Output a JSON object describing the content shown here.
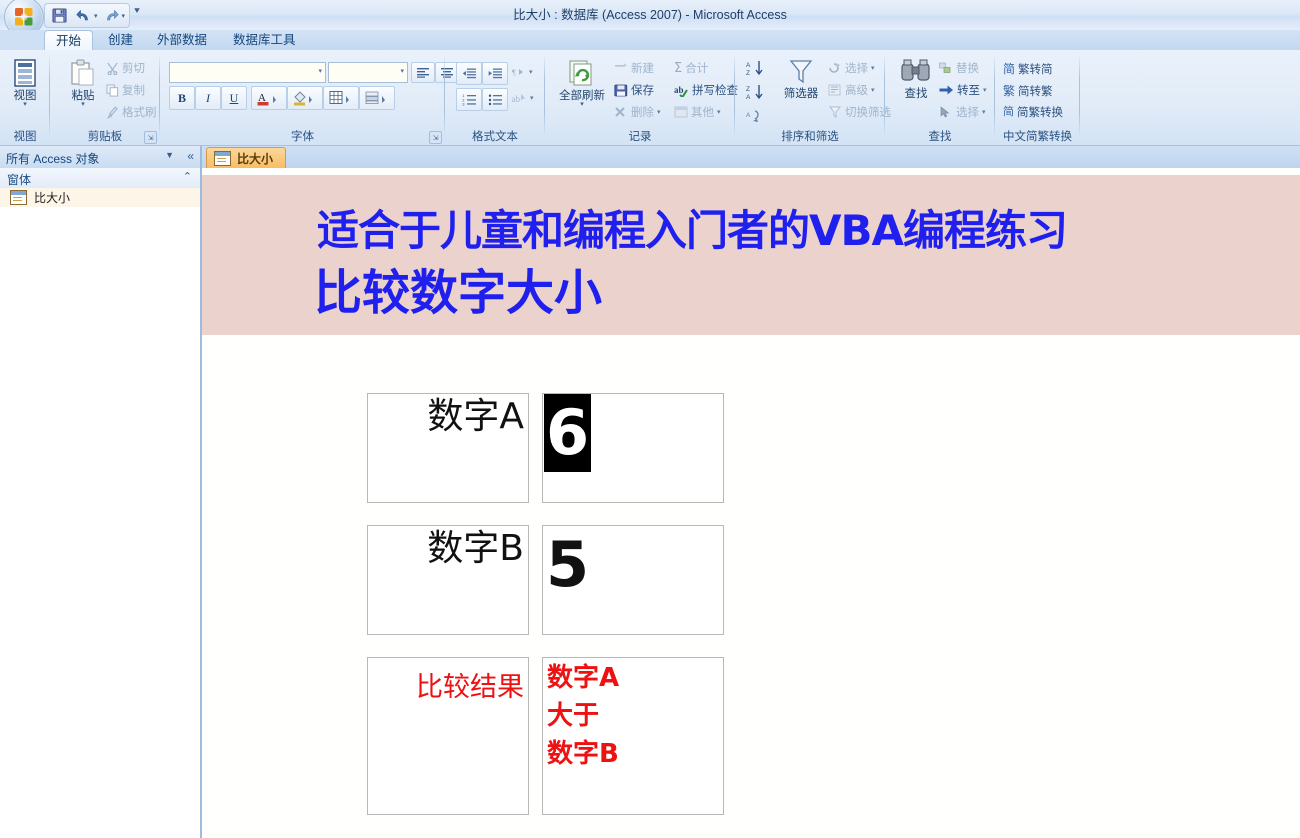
{
  "window": {
    "title": "比大小 : 数据库 (Access 2007) - Microsoft Access",
    "office_button": "office-orb"
  },
  "quick_access": {
    "save": "保存",
    "undo": "撤消",
    "redo": "恢复",
    "customize": "自定义快速访问工具栏"
  },
  "ribbon": {
    "tabs": [
      {
        "label": "开始",
        "active": true
      },
      {
        "label": "创建",
        "active": false
      },
      {
        "label": "外部数据",
        "active": false
      },
      {
        "label": "数据库工具",
        "active": false
      }
    ],
    "groups": [
      {
        "name": "view",
        "label": "视图",
        "buttons": [
          {
            "label": "视图",
            "dropdown": "▾"
          }
        ]
      },
      {
        "name": "clipboard",
        "label": "剪贴板",
        "buttons": [
          {
            "label": "粘贴",
            "dropdown": "▾"
          },
          {
            "label": "剪切"
          },
          {
            "label": "复制"
          },
          {
            "label": "格式刷"
          }
        ]
      },
      {
        "name": "font",
        "label": "字体",
        "font_name": "",
        "font_size": "",
        "buttons": [
          {
            "label": "B"
          },
          {
            "label": "I"
          },
          {
            "label": "U"
          },
          {
            "label": "字体颜色"
          },
          {
            "label": "填充颜色"
          },
          {
            "label": "网格线"
          },
          {
            "label": "备用填充色"
          },
          {
            "label": "左对齐"
          },
          {
            "label": "居中"
          },
          {
            "label": "右对齐"
          }
        ]
      },
      {
        "name": "rich-text",
        "label": "格式文本",
        "buttons": [
          {
            "label": "减少缩进"
          },
          {
            "label": "增加缩进"
          },
          {
            "label": "从右向左"
          },
          {
            "label": "编号"
          },
          {
            "label": "项目符号"
          },
          {
            "label": "拼音指南"
          }
        ]
      },
      {
        "name": "records",
        "label": "记录",
        "buttons": [
          {
            "label": "全部刷新",
            "dropdown": "▾"
          },
          {
            "label": "新建"
          },
          {
            "label": "保存"
          },
          {
            "label": "删除",
            "dropdown": "▾"
          },
          {
            "label": "合计"
          },
          {
            "label": "拼写检查"
          },
          {
            "label": "其他",
            "dropdown": "▾"
          }
        ]
      },
      {
        "name": "sort-filter",
        "label": "排序和筛选",
        "buttons": [
          {
            "label": "升序"
          },
          {
            "label": "降序"
          },
          {
            "label": "清除所有排序"
          },
          {
            "label": "筛选器"
          },
          {
            "label": "选择",
            "dropdown": "▾"
          },
          {
            "label": "高级",
            "dropdown": "▾"
          },
          {
            "label": "切换筛选"
          }
        ]
      },
      {
        "name": "find",
        "label": "查找",
        "buttons": [
          {
            "label": "查找"
          },
          {
            "label": "替换"
          },
          {
            "label": "转至",
            "dropdown": "▾"
          },
          {
            "label": "选择",
            "dropdown": "▾"
          }
        ]
      },
      {
        "name": "chinese-conversion",
        "label": "中文简繁转换",
        "buttons": [
          {
            "label": "繁转简"
          },
          {
            "label": "简转繁"
          },
          {
            "label": "简繁转换"
          }
        ]
      }
    ]
  },
  "nav_pane": {
    "header_title": "所有 Access 对象",
    "dropdown_icon": "chevron-down-icon",
    "collapse_icon": "«",
    "group_label": "窗体",
    "group_chevron": "⌃",
    "items": [
      {
        "label": "比大小",
        "icon": "form-icon"
      }
    ]
  },
  "doc_tabs": [
    {
      "label": "比大小",
      "icon": "form-icon",
      "active": true
    }
  ],
  "form": {
    "header": {
      "line1": "适合于儿童和编程入门者的VBA编程练习",
      "line2": "比较数字大小",
      "bg_color": "#ecd2cd",
      "text_color": "#1f1fee"
    },
    "rows": [
      {
        "name": "number-a",
        "label": "数字A",
        "value": "6",
        "selected": true
      },
      {
        "name": "number-b",
        "label": "数字B",
        "value": "5",
        "selected": false
      }
    ],
    "result": {
      "label": "比较结果",
      "label_color": "#ee1111",
      "lines": [
        "数字A",
        "大于",
        "数字B"
      ],
      "text_color": "#ee1111"
    }
  }
}
